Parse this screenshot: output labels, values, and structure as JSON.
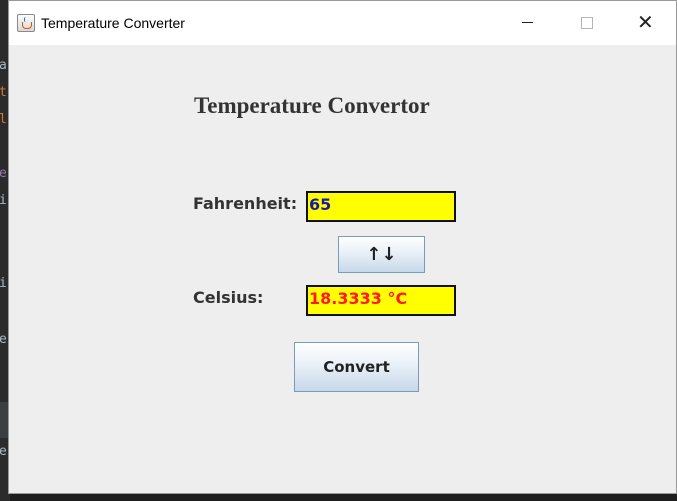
{
  "background": {
    "chars": [
      "a",
      "t",
      "l",
      "e",
      "i",
      "i",
      "e",
      "e"
    ]
  },
  "window": {
    "title": "Temperature Converter",
    "icons": {
      "app": "java-cup-icon",
      "minimize": "minimize-icon",
      "maximize": "maximize-icon",
      "close": "close-icon"
    },
    "close_glyph": "✕"
  },
  "form": {
    "heading": "Temperature Convertor",
    "fahrenheit_label": "Fahrenheit:",
    "fahrenheit_value": "65",
    "swap_label": "↑↓",
    "celsius_label": "Celsius:",
    "celsius_value": "18.3333 °C",
    "convert_label": "Convert"
  },
  "colors": {
    "field_background": "#ffff00",
    "fahrenheit_text": "#1a1aa8",
    "celsius_text": "#ff1a1a"
  }
}
